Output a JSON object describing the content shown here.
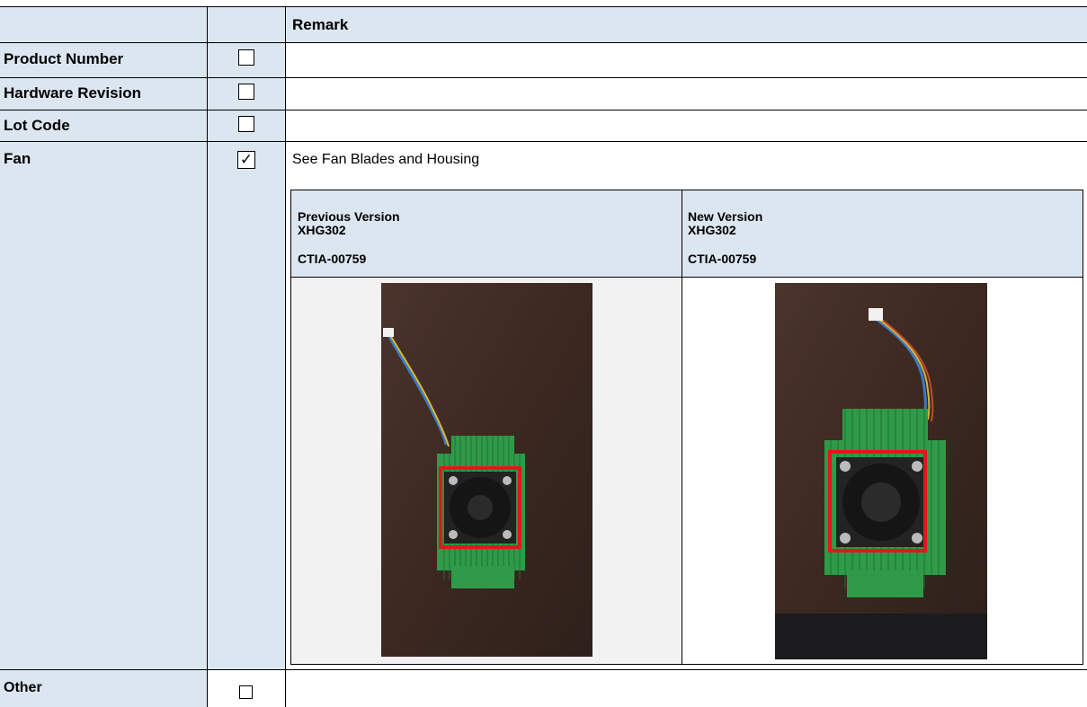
{
  "table": {
    "header": {
      "remark_label": "Remark"
    },
    "rows": [
      {
        "label": "Product Number",
        "checked": false,
        "remark": ""
      },
      {
        "label": "Hardware Revision",
        "checked": false,
        "remark": ""
      },
      {
        "label": "Lot Code",
        "checked": false,
        "remark": ""
      },
      {
        "label": "Fan",
        "checked": true,
        "remark": "See Fan Blades and Housing"
      },
      {
        "label": "Other",
        "checked": false,
        "remark": ""
      }
    ],
    "checkmark": "✓",
    "fan_comparison": {
      "previous": {
        "title": "Previous Version",
        "model": "XHG302",
        "code": "CTIA-00759"
      },
      "new": {
        "title": "New Version",
        "model": "XHG302",
        "code": "CTIA-00759"
      }
    }
  },
  "colors": {
    "label_bg": "#dce6f1",
    "highlight": "#e8141c",
    "heatsink": "#2f9a48",
    "desk": "#3e2a23"
  }
}
